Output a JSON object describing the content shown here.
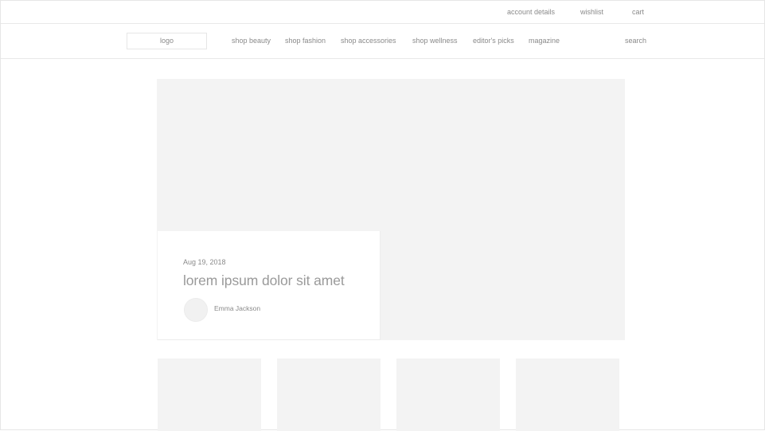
{
  "utility_bar": {
    "links": [
      {
        "label": "account details"
      },
      {
        "label": "wishlist"
      },
      {
        "label": "cart"
      }
    ]
  },
  "main_nav": {
    "logo": "logo",
    "links": [
      {
        "label": "shop beauty"
      },
      {
        "label": "shop fashion"
      },
      {
        "label": "shop accessories"
      },
      {
        "label": "shop wellness"
      },
      {
        "label": "editor's picks"
      },
      {
        "label": "magazine"
      }
    ],
    "search": "search"
  },
  "hero": {
    "date": "Aug 19, 2018",
    "title": "lorem ipsum dolor sit amet",
    "author": "Emma Jackson"
  },
  "colors": {
    "background": "#ffffff",
    "placeholder": "#f3f3f3",
    "border": "#e6e6e6",
    "text": "#8a8a8a"
  }
}
